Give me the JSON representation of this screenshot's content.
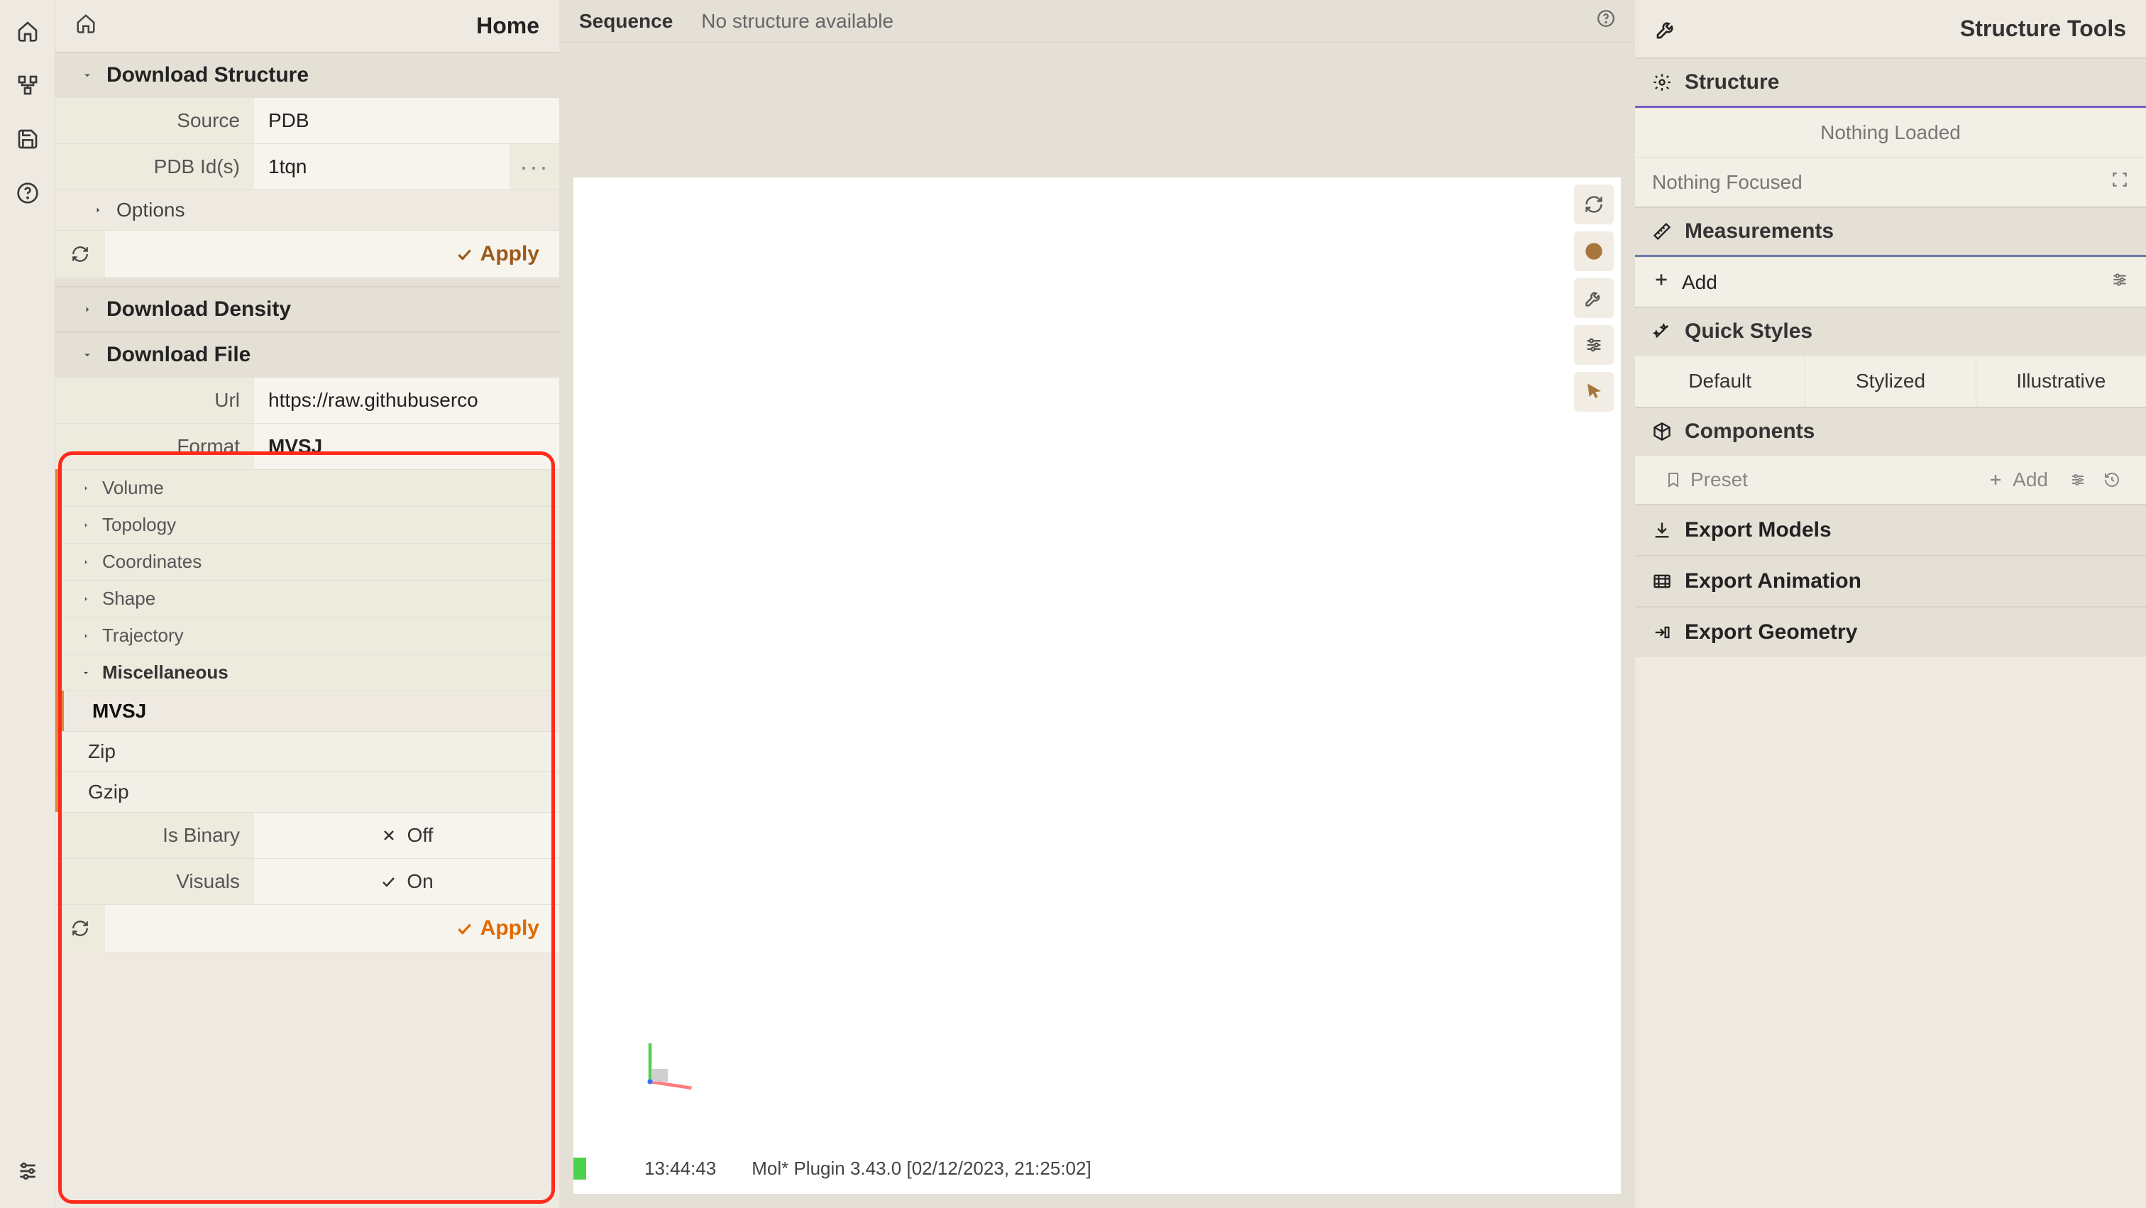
{
  "left": {
    "home": "Home",
    "downloadStructure": {
      "title": "Download Structure",
      "source_label": "Source",
      "source_value": "PDB",
      "pdbid_label": "PDB Id(s)",
      "pdbid_value": "1tqn",
      "options": "Options",
      "apply": "Apply"
    },
    "downloadDensity": {
      "title": "Download Density"
    },
    "downloadFile": {
      "title": "Download File",
      "url_label": "Url",
      "url_value": "https://raw.githubuserco",
      "format_label": "Format",
      "format_value": "MVSJ",
      "groups": {
        "volume": "Volume",
        "topology": "Topology",
        "coordinates": "Coordinates",
        "shape": "Shape",
        "trajectory": "Trajectory",
        "misc": "Miscellaneous"
      },
      "formats": {
        "mvsj": "MVSJ",
        "zip": "Zip",
        "gzip": "Gzip"
      },
      "isBinary_label": "Is Binary",
      "isBinary_value": "Off",
      "visuals_label": "Visuals",
      "visuals_value": "On",
      "apply": "Apply"
    }
  },
  "center": {
    "sequence_label": "Sequence",
    "sequence_msg": "No structure available",
    "status_time": "13:44:43",
    "status_msg": "Mol* Plugin 3.43.0 [02/12/2023, 21:25:02]"
  },
  "right": {
    "title": "Structure Tools",
    "structure": {
      "title": "Structure",
      "nothing_loaded": "Nothing Loaded",
      "nothing_focused": "Nothing Focused"
    },
    "measurements": {
      "title": "Measurements",
      "add": "Add"
    },
    "quickStyles": {
      "title": "Quick Styles",
      "default": "Default",
      "stylized": "Stylized",
      "illustrative": "Illustrative"
    },
    "components": {
      "title": "Components",
      "preset": "Preset",
      "add": "Add"
    },
    "exportModels": "Export Models",
    "exportAnimation": "Export Animation",
    "exportGeometry": "Export Geometry"
  }
}
